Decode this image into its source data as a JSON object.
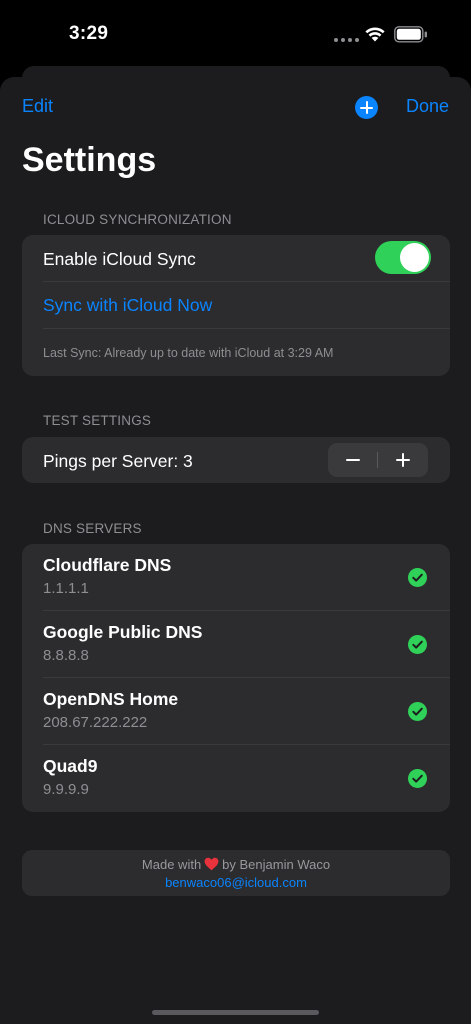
{
  "status_bar": {
    "time": "3:29"
  },
  "nav": {
    "edit_label": "Edit",
    "done_label": "Done",
    "title": "Settings"
  },
  "icloud": {
    "header": "ICLOUD SYNCHRONIZATION",
    "enable_label": "Enable iCloud Sync",
    "enabled": true,
    "sync_now_label": "Sync with iCloud Now",
    "last_sync": "Last Sync: Already up to date with iCloud at 3:29 AM"
  },
  "test_settings": {
    "header": "TEST SETTINGS",
    "pings_label": "Pings per Server: 3"
  },
  "dns": {
    "header": "DNS SERVERS",
    "servers": [
      {
        "name": "Cloudflare DNS",
        "address": "1.1.1.1",
        "selected": true
      },
      {
        "name": "Google Public DNS",
        "address": "8.8.8.8",
        "selected": true
      },
      {
        "name": "OpenDNS Home",
        "address": "208.67.222.222",
        "selected": true
      },
      {
        "name": "Quad9",
        "address": "9.9.9.9",
        "selected": true
      }
    ]
  },
  "footer": {
    "made_with": "Made with",
    "by": "by Benjamin Waco",
    "email": "benwaco06@icloud.com"
  },
  "colors": {
    "accent": "#0a84ff",
    "success": "#30d158",
    "background": "#1c1c1e",
    "cell": "#2c2c2e"
  }
}
